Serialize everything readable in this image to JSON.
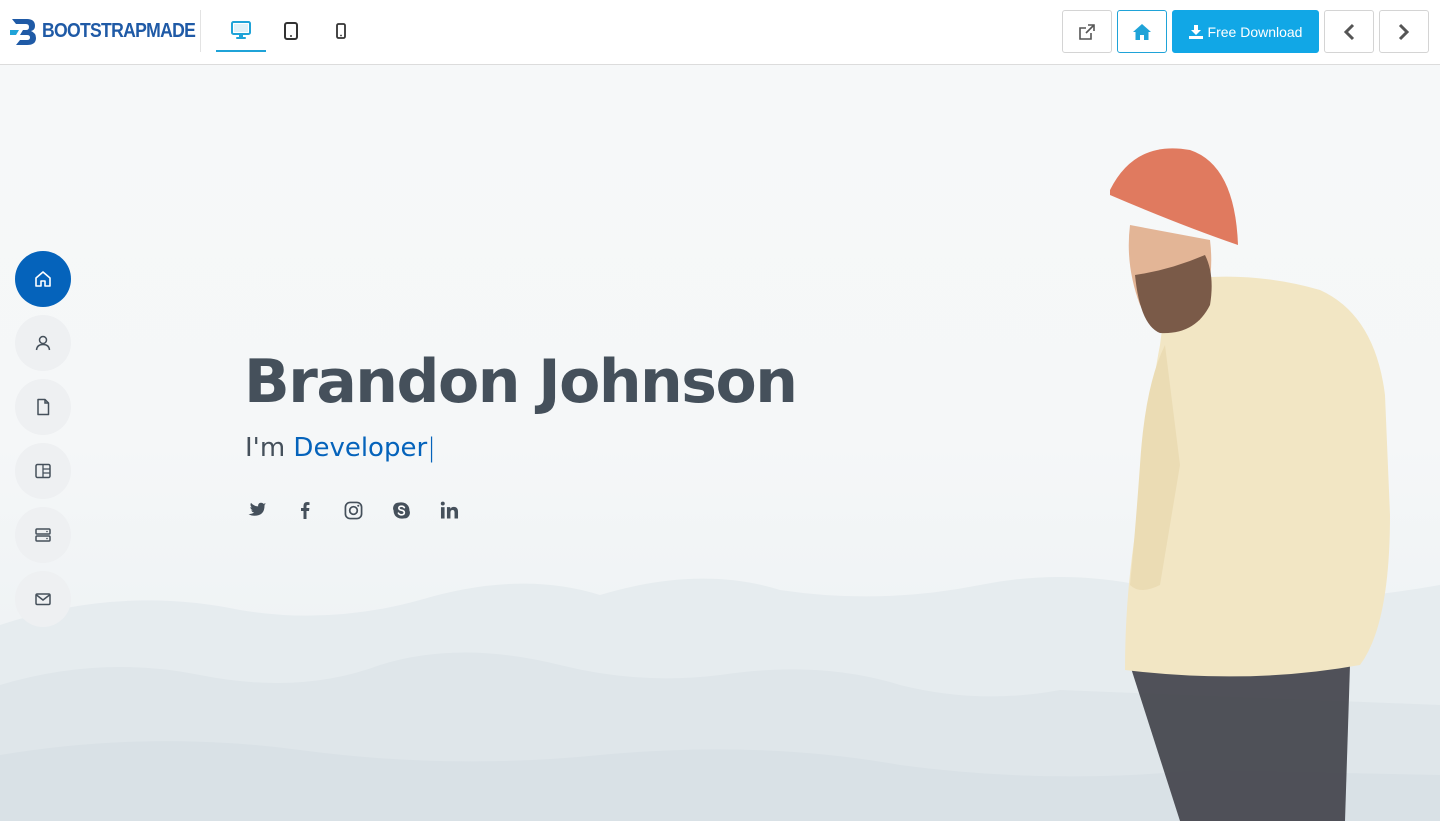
{
  "toolbar": {
    "brand": "BOOTSTRAPMADE",
    "devices": [
      {
        "name": "desktop",
        "icon": "desktop-icon",
        "active": true
      },
      {
        "name": "tablet",
        "icon": "tablet-icon",
        "active": false
      },
      {
        "name": "mobile",
        "icon": "mobile-icon",
        "active": false
      }
    ],
    "download_label": "Free Download",
    "colors": {
      "accent": "#1fa3d8",
      "download_bg": "#11a7e6",
      "brand": "#1f5aa6"
    }
  },
  "sidenav": {
    "items": [
      {
        "icon": "home-icon",
        "active": true
      },
      {
        "icon": "person-icon",
        "active": false
      },
      {
        "icon": "file-icon",
        "active": false
      },
      {
        "icon": "layout-icon",
        "active": false
      },
      {
        "icon": "server-icon",
        "active": false
      },
      {
        "icon": "envelope-icon",
        "active": false
      }
    ],
    "colors": {
      "active": "#0563bb",
      "inactive": "#eef0f2"
    }
  },
  "hero": {
    "name": "Brandon Johnson",
    "prefix": "I'm",
    "role": "Developer",
    "cursor": "|",
    "socials": [
      "twitter-icon",
      "facebook-icon",
      "instagram-icon",
      "skype-icon",
      "linkedin-icon"
    ],
    "colors": {
      "text": "#45505b",
      "accent": "#0563bb"
    }
  }
}
